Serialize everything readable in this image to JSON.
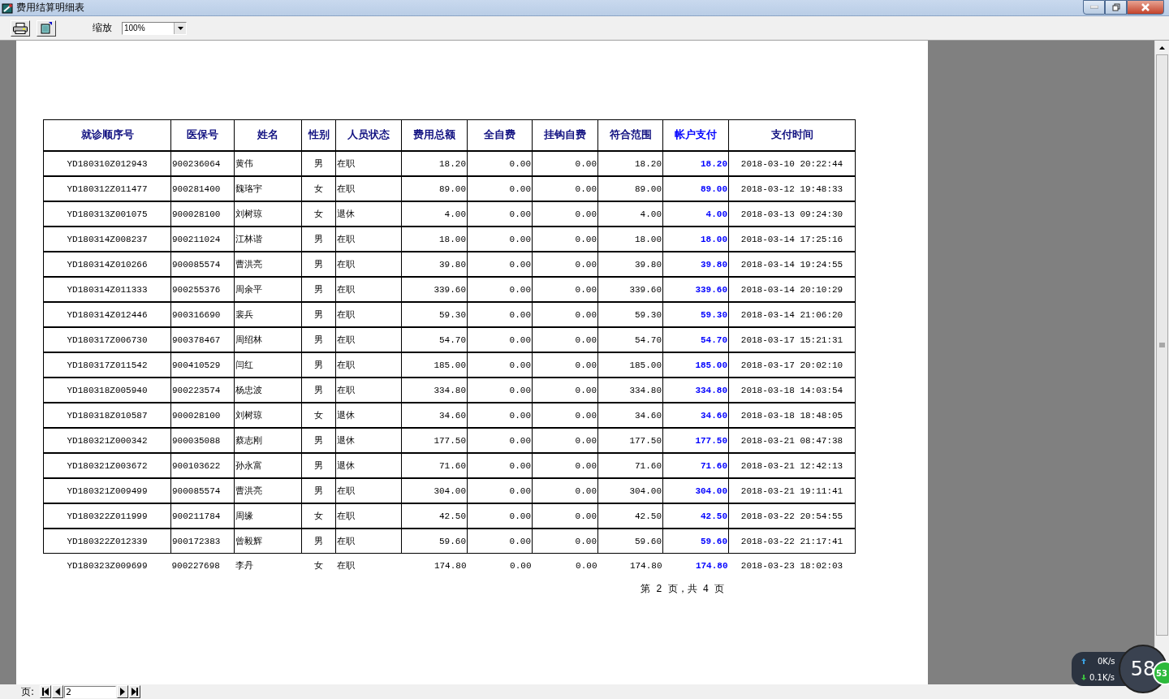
{
  "window": {
    "title": "费用结算明细表"
  },
  "toolbar": {
    "zoom_label": "缩放",
    "zoom_value": "100%"
  },
  "table": {
    "columns": [
      {
        "label": "就诊顺序号",
        "emphasis": false
      },
      {
        "label": "医保号",
        "emphasis": false
      },
      {
        "label": "姓名",
        "emphasis": false
      },
      {
        "label": "性别",
        "emphasis": false
      },
      {
        "label": "人员状态",
        "emphasis": false
      },
      {
        "label": "费用总额",
        "emphasis": false
      },
      {
        "label": "全自费",
        "emphasis": false
      },
      {
        "label": "挂钩自费",
        "emphasis": false
      },
      {
        "label": "符合范围",
        "emphasis": false
      },
      {
        "label": "帐户支付",
        "emphasis": true
      },
      {
        "label": "支付时间",
        "emphasis": false
      }
    ],
    "rows": [
      {
        "kind": "boxed",
        "cells": [
          "YD180310Z012943",
          "900236064",
          "黄伟",
          "男",
          "在职",
          "18.20",
          "0.00",
          "0.00",
          "18.20",
          "18.20",
          "2018-03-10 20:22:44"
        ]
      },
      {
        "kind": "boxed",
        "cells": [
          "YD180312Z011477",
          "900281400",
          "魏珞宇",
          "女",
          "在职",
          "89.00",
          "0.00",
          "0.00",
          "89.00",
          "89.00",
          "2018-03-12 19:48:33"
        ]
      },
      {
        "kind": "boxed",
        "cells": [
          "YD180313Z001075",
          "900028100",
          "刘树琼",
          "女",
          "退休",
          "4.00",
          "0.00",
          "0.00",
          "4.00",
          "4.00",
          "2018-03-13 09:24:30"
        ]
      },
      {
        "kind": "boxed",
        "cells": [
          "YD180314Z008237",
          "900211024",
          "江林谐",
          "男",
          "在职",
          "18.00",
          "0.00",
          "0.00",
          "18.00",
          "18.00",
          "2018-03-14 17:25:16"
        ]
      },
      {
        "kind": "boxed",
        "cells": [
          "YD180314Z010266",
          "900085574",
          "曹洪亮",
          "男",
          "在职",
          "39.80",
          "0.00",
          "0.00",
          "39.80",
          "39.80",
          "2018-03-14 19:24:55"
        ]
      },
      {
        "kind": "boxed",
        "cells": [
          "YD180314Z011333",
          "900255376",
          "周余平",
          "男",
          "在职",
          "339.60",
          "0.00",
          "0.00",
          "339.60",
          "339.60",
          "2018-03-14 20:10:29"
        ]
      },
      {
        "kind": "boxed",
        "cells": [
          "YD180314Z012446",
          "900316690",
          "裴兵",
          "男",
          "在职",
          "59.30",
          "0.00",
          "0.00",
          "59.30",
          "59.30",
          "2018-03-14 21:06:20"
        ]
      },
      {
        "kind": "boxed",
        "cells": [
          "YD180317Z006730",
          "900378467",
          "周绍林",
          "男",
          "在职",
          "54.70",
          "0.00",
          "0.00",
          "54.70",
          "54.70",
          "2018-03-17 15:21:31"
        ]
      },
      {
        "kind": "boxed",
        "cells": [
          "YD180317Z011542",
          "900410529",
          "闫红",
          "男",
          "在职",
          "185.00",
          "0.00",
          "0.00",
          "185.00",
          "185.00",
          "2018-03-17 20:02:10"
        ]
      },
      {
        "kind": "boxed",
        "cells": [
          "YD180318Z005940",
          "900223574",
          "杨忠波",
          "男",
          "在职",
          "334.80",
          "0.00",
          "0.00",
          "334.80",
          "334.80",
          "2018-03-18 14:03:54"
        ]
      },
      {
        "kind": "boxed",
        "cells": [
          "YD180318Z010587",
          "900028100",
          "刘树琼",
          "女",
          "退休",
          "34.60",
          "0.00",
          "0.00",
          "34.60",
          "34.60",
          "2018-03-18 18:48:05"
        ]
      },
      {
        "kind": "boxed",
        "cells": [
          "YD180321Z000342",
          "900035088",
          "蔡志刚",
          "男",
          "退休",
          "177.50",
          "0.00",
          "0.00",
          "177.50",
          "177.50",
          "2018-03-21 08:47:38"
        ]
      },
      {
        "kind": "boxed",
        "cells": [
          "YD180321Z003672",
          "900103622",
          "孙永富",
          "男",
          "退休",
          "71.60",
          "0.00",
          "0.00",
          "71.60",
          "71.60",
          "2018-03-21 12:42:13"
        ]
      },
      {
        "kind": "boxed",
        "cells": [
          "YD180321Z009499",
          "900085574",
          "曹洪亮",
          "男",
          "在职",
          "304.00",
          "0.00",
          "0.00",
          "304.00",
          "304.00",
          "2018-03-21 19:11:41"
        ]
      },
      {
        "kind": "boxed",
        "cells": [
          "YD180322Z011999",
          "900211784",
          "周缘",
          "女",
          "在职",
          "42.50",
          "0.00",
          "0.00",
          "42.50",
          "42.50",
          "2018-03-22 20:54:55"
        ]
      },
      {
        "kind": "boxed",
        "cells": [
          "YD180322Z012339",
          "900172383",
          "曾毅辉",
          "男",
          "在职",
          "59.60",
          "0.00",
          "0.00",
          "59.60",
          "59.60",
          "2018-03-22 21:17:41"
        ]
      },
      {
        "kind": "plain",
        "cells": [
          "YD180323Z009699",
          "900227698",
          "李丹",
          "女",
          "在职",
          "174.80",
          "0.00",
          "0.00",
          "174.80",
          "174.80",
          "2018-03-23 18:02:03"
        ]
      }
    ]
  },
  "page_footer": "第 2 页，共 4 页",
  "pager": {
    "label": "页:",
    "page": "2"
  },
  "net_monitor": {
    "upload": "0K/s",
    "download": "0.1K/s",
    "cpu": "58",
    "memory": "53"
  }
}
